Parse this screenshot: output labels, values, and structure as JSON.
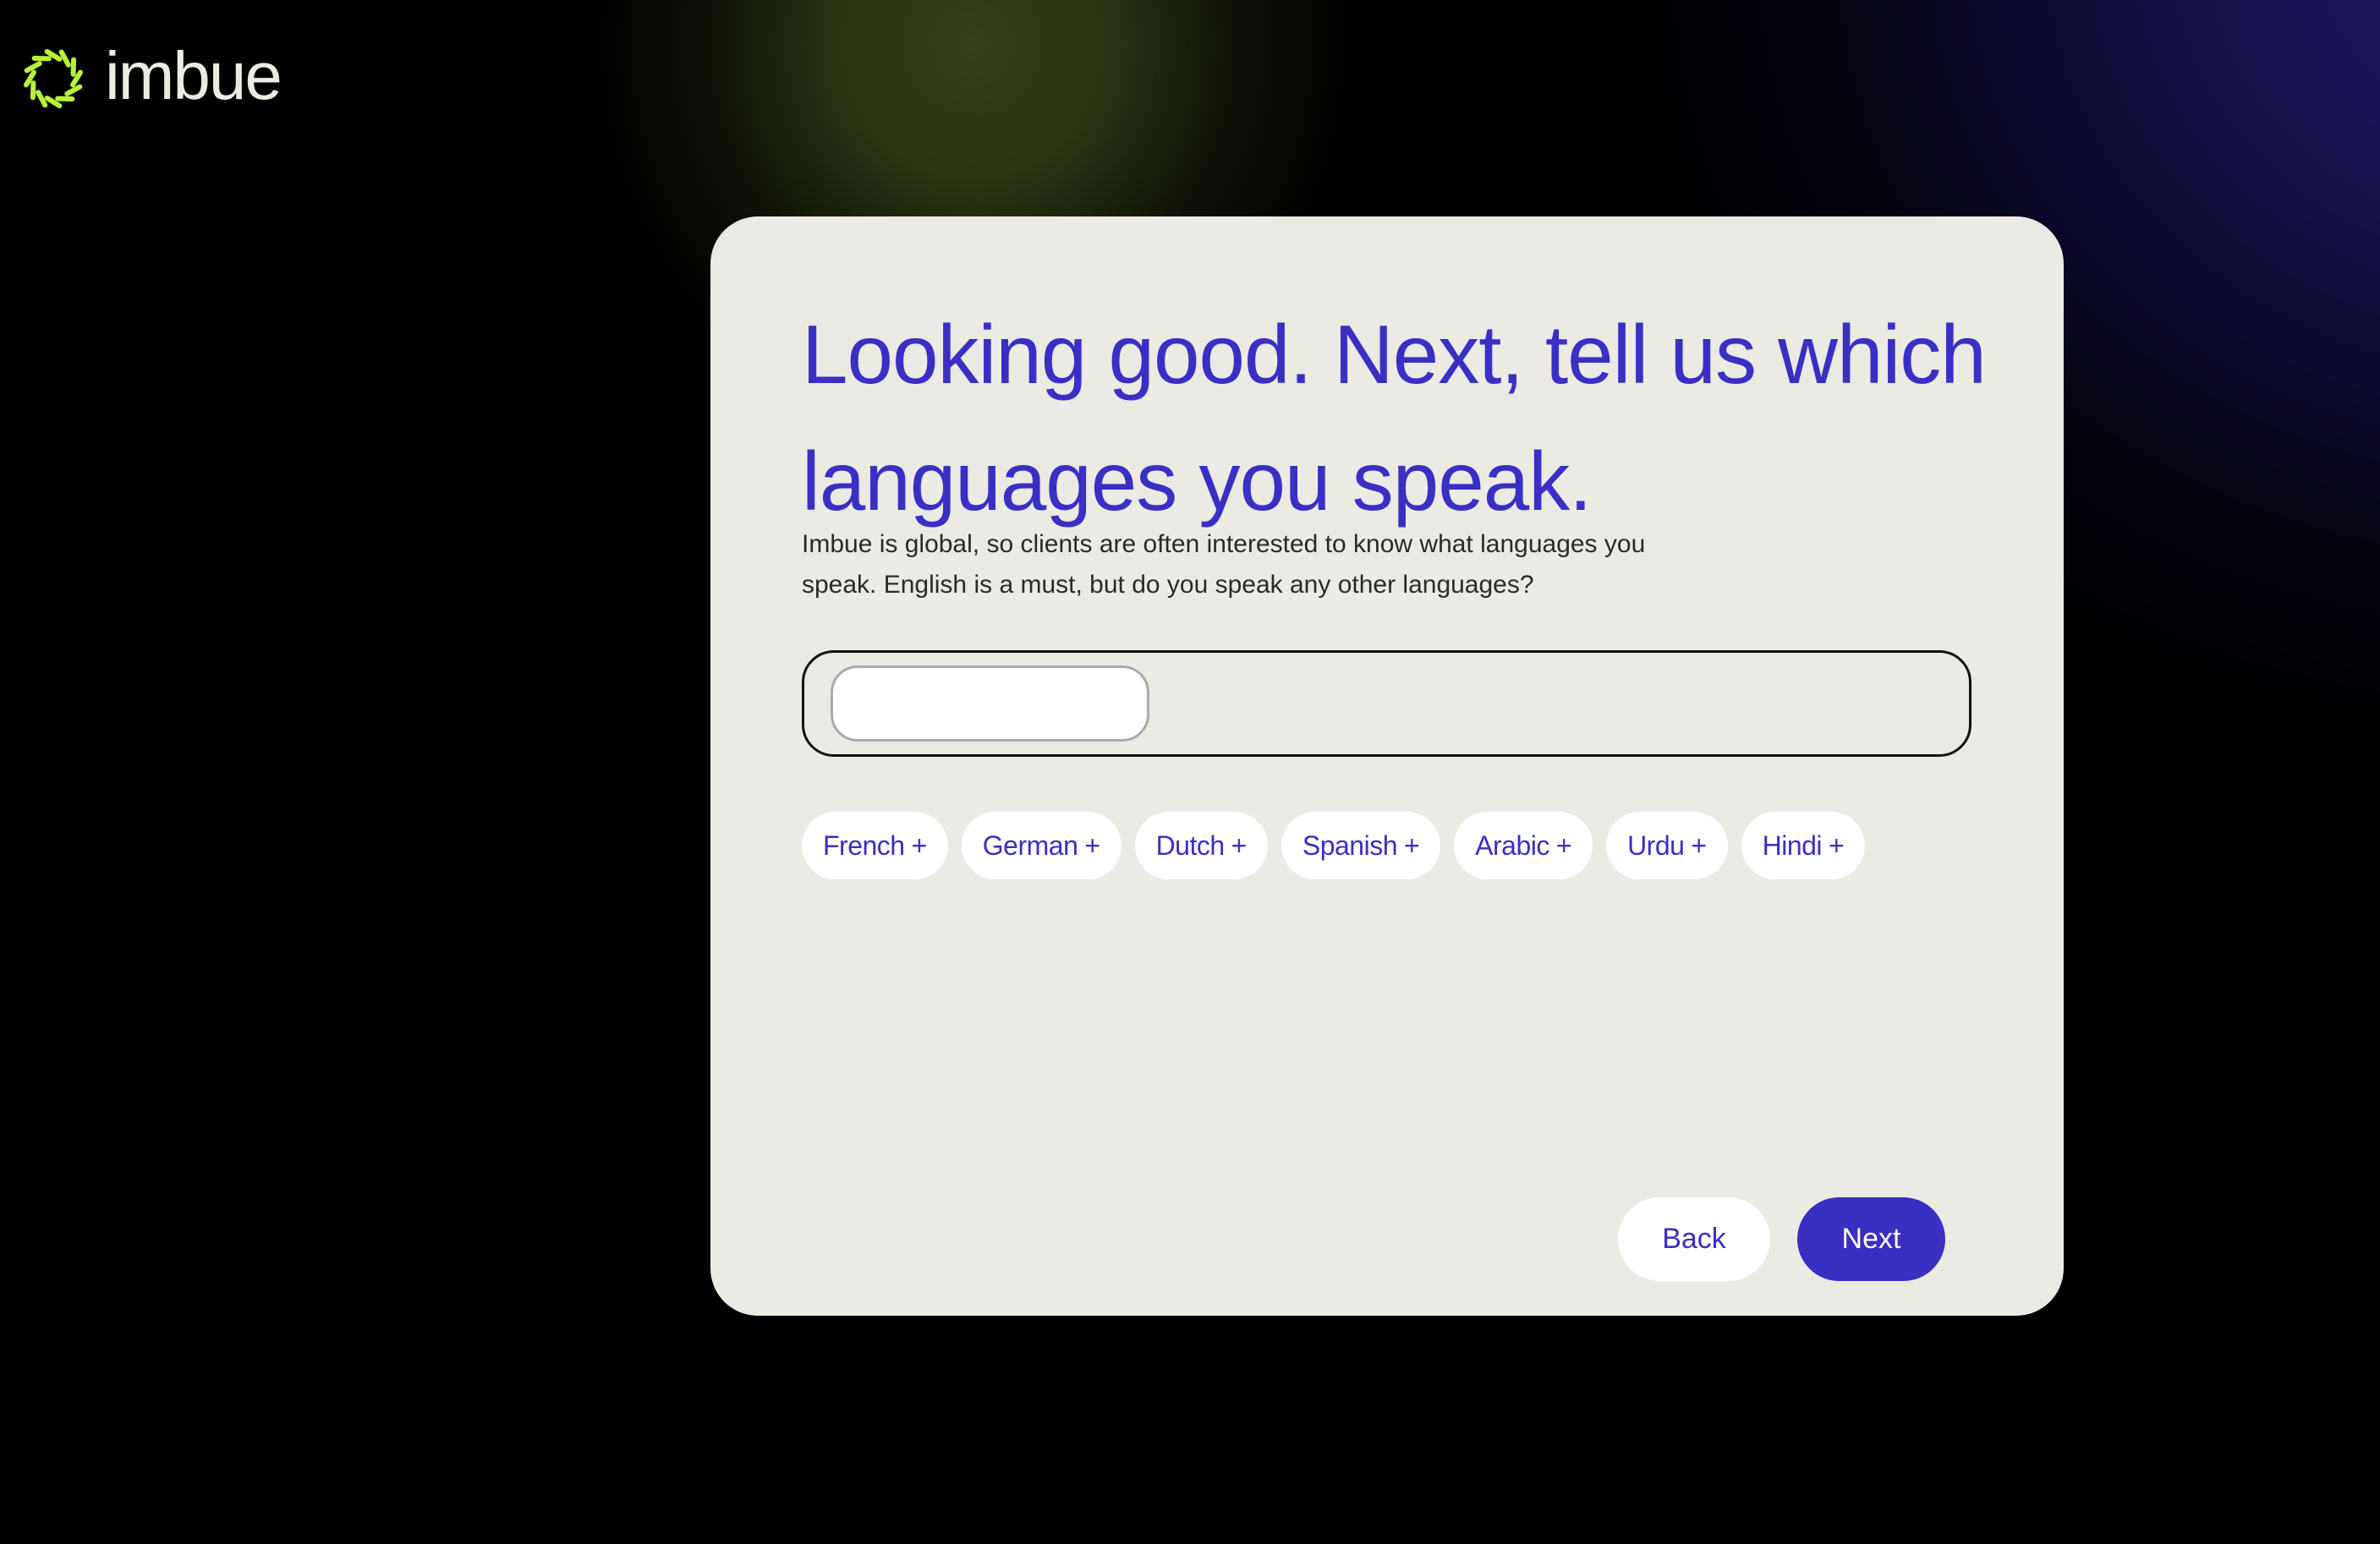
{
  "brand": {
    "name": "imbue",
    "logo_icon": "sunburst-dashes-icon",
    "accent_color": "#b8f03c"
  },
  "colors": {
    "primary": "#3a2fc4",
    "card_background": "#ebeae3",
    "page_background": "#000000",
    "body_text": "#2a2a2a"
  },
  "card": {
    "headline": "Looking good. Next, tell us which languages you speak.",
    "subtitle": "Imbue is global, so clients are often interested to know what languages you speak. English is a must, but do you speak any other languages?",
    "language_input": {
      "value": "",
      "placeholder": ""
    },
    "suggestions": [
      {
        "label": "French",
        "icon": "+"
      },
      {
        "label": "German",
        "icon": "+"
      },
      {
        "label": "Dutch",
        "icon": "+"
      },
      {
        "label": "Spanish",
        "icon": "+"
      },
      {
        "label": "Arabic",
        "icon": "+"
      },
      {
        "label": "Urdu",
        "icon": "+"
      },
      {
        "label": "Hindi",
        "icon": "+"
      }
    ],
    "buttons": {
      "back_label": "Back",
      "next_label": "Next"
    }
  }
}
